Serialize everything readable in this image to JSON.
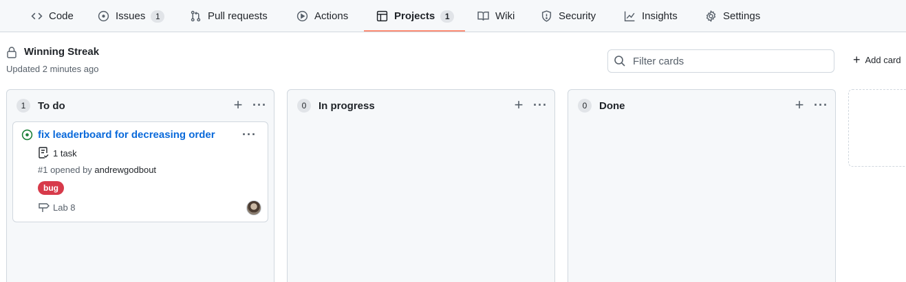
{
  "repo_nav": {
    "tabs": [
      {
        "label": "Code",
        "icon": "code-icon",
        "count": ""
      },
      {
        "label": "Issues",
        "icon": "issue-opened-icon",
        "count": "1"
      },
      {
        "label": "Pull requests",
        "icon": "pull-request-icon",
        "count": ""
      },
      {
        "label": "Actions",
        "icon": "play-icon",
        "count": ""
      },
      {
        "label": "Projects",
        "icon": "table-icon",
        "count": "1",
        "active": true
      },
      {
        "label": "Wiki",
        "icon": "book-icon",
        "count": ""
      },
      {
        "label": "Security",
        "icon": "shield-icon",
        "count": ""
      },
      {
        "label": "Insights",
        "icon": "graph-icon",
        "count": ""
      },
      {
        "label": "Settings",
        "icon": "gear-icon",
        "count": ""
      }
    ]
  },
  "project": {
    "title": "Winning Streak",
    "updated": "Updated 2 minutes ago",
    "filter_placeholder": "Filter cards",
    "add_cards_label": "Add card"
  },
  "columns": [
    {
      "name": "To do",
      "count": "1",
      "cards": [
        {
          "title": "fix leaderboard for decreasing order",
          "tasks": "1 task",
          "opened_prefix": "#1 opened by ",
          "author": "andrewgodbout",
          "label": "bug",
          "milestone": "Lab 8"
        }
      ]
    },
    {
      "name": "In progress",
      "count": "0",
      "cards": []
    },
    {
      "name": "Done",
      "count": "0",
      "cards": []
    }
  ],
  "colors": {
    "accent_underline": "#fd8c73",
    "link": "#0969da",
    "bug_label": "#d73a4a",
    "issue_open": "#1a7f37"
  }
}
